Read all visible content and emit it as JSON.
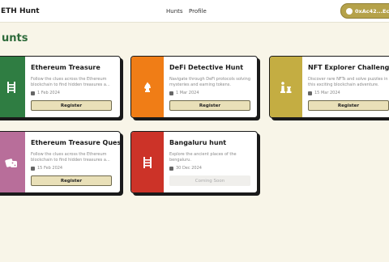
{
  "header": {
    "brand": "ETH Hunt",
    "nav": [
      "Hunts",
      "Profile"
    ],
    "wallet": "0xAc42...Ec"
  },
  "section": {
    "title": "unts"
  },
  "cards": [
    {
      "title": "Ethereum Treasure",
      "description": "Follow the clues across the Ethereum blockchain to find hidden treasures a...",
      "date": "1 Feb 2024",
      "button": "Register",
      "color": "#2f7d42",
      "icon": "ladder-icon"
    },
    {
      "title": "DeFi Detective Hunt",
      "description": "Navigate through DeFi protocols solving mysteries and earning tokens.",
      "date": "1 Mar 2024",
      "button": "Register",
      "color": "#f07d16",
      "icon": "chess-knight-icon"
    },
    {
      "title": "NFT Explorer Challenge",
      "description": "Discover rare NFTs and solve puzzles in this exciting blockchain adventure.",
      "date": "15 Mar 2024",
      "button": "Register",
      "color": "#c4ad42",
      "icon": "chess-pieces-icon"
    },
    {
      "title": "Ethereum Treasure Quest",
      "description": "Follow the clues across the Ethereum blockchain to find hidden treasures a...",
      "date": "15 Feb 2024",
      "button": "Register",
      "color": "#b86e9a",
      "icon": "dice-icon"
    },
    {
      "title": "Bangaluru hunt",
      "description": "Explore the ancient places of the bengaluru.",
      "date": "30 Dec 2024",
      "button": "Coming Soon",
      "color": "#cc3328",
      "icon": "ladder-icon"
    }
  ]
}
